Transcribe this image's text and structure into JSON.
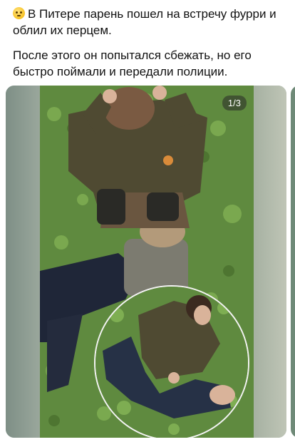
{
  "post": {
    "emoji": "face-with-raised-eyebrow-emoji",
    "line1": "В Питере парень пошел на встречу фурри и облил их перцем.",
    "line2": "После этого он попытался сбежать, но его быстро поймали и передали полиции."
  },
  "media": {
    "counter": "1/3"
  },
  "colors": {
    "grass": "#5f8a3f",
    "jacket": "#4f4a32",
    "jeans": "#1f2638"
  }
}
